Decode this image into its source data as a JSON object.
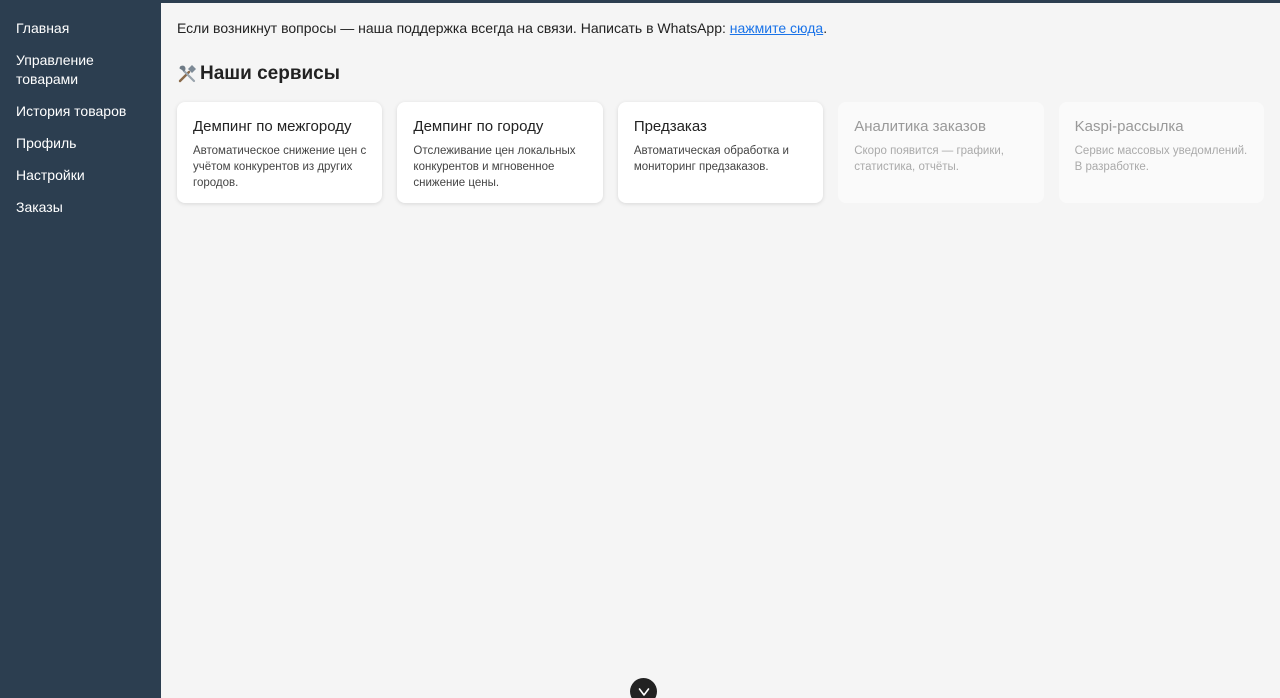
{
  "sidebar": {
    "items": [
      {
        "label": "Главная"
      },
      {
        "label": "Управление товарами"
      },
      {
        "label": "История товаров"
      },
      {
        "label": "Профиль"
      },
      {
        "label": "Настройки"
      },
      {
        "label": "Заказы"
      }
    ]
  },
  "support": {
    "text": "Если возникнут вопросы — наша поддержка всегда на связи. Написать в WhatsApp: ",
    "link_label": "нажмите сюда",
    "suffix": "."
  },
  "services": {
    "icon": "tools-icon",
    "title": "Наши сервисы",
    "cards": [
      {
        "title": "Демпинг по межгороду",
        "description": "Автоматическое снижение цен с учётом конкурентов из других городов.",
        "enabled": true
      },
      {
        "title": "Демпинг по городу",
        "description": "Отслеживание цен локальных конкурентов и мгновенное снижение цены.",
        "enabled": true
      },
      {
        "title": "Предзаказ",
        "description": "Автоматическая обработка и мониторинг предзаказов.",
        "enabled": true
      },
      {
        "title": "Аналитика заказов",
        "description": "Скоро появится — графики, статистика, отчёты.",
        "enabled": false
      },
      {
        "title": "Kaspi-рассылка",
        "description": "Сервис массовых уведомлений. В разработке.",
        "enabled": false
      }
    ]
  },
  "colors": {
    "sidebar": "#2c3e50",
    "background": "#f5f5f5",
    "link": "#1a73e8"
  },
  "bottom_button": {
    "icon": "chevron-down-icon"
  }
}
